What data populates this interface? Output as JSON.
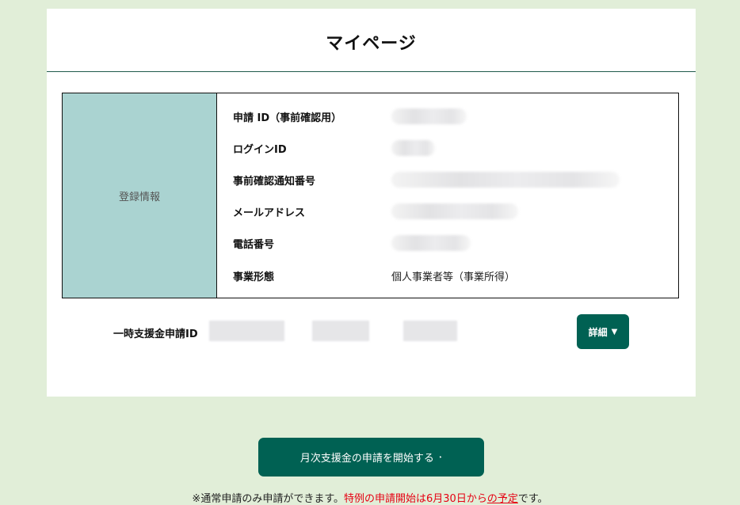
{
  "page": {
    "title": "マイページ"
  },
  "registration": {
    "header": "登録情報",
    "rows": [
      {
        "label": "申請 ID（事前確認用）",
        "value": ""
      },
      {
        "label": "ログインID",
        "value": ""
      },
      {
        "label": "事前確認通知番号",
        "value": ""
      },
      {
        "label": "メールアドレス",
        "value": ""
      },
      {
        "label": "電話番号",
        "value": ""
      },
      {
        "label": "事業形態",
        "value": "個人事業者等（事業所得）"
      }
    ]
  },
  "application": {
    "label": "一時支援金申請ID",
    "detail_button": "詳細",
    "detail_icon": "▼"
  },
  "actions": {
    "start_button": "月次支援金の申請を開始する",
    "start_icon": "‣"
  },
  "note": {
    "part1": "※通常申請のみ申請ができます。",
    "part2": "特例の申請開始は6月30日から",
    "part3": "の予定",
    "part4": "です。"
  },
  "colors": {
    "background": "#e1eed8",
    "brand_green": "#006153",
    "header_cell": "#aad3d1",
    "emphasis_red": "#e60012"
  }
}
